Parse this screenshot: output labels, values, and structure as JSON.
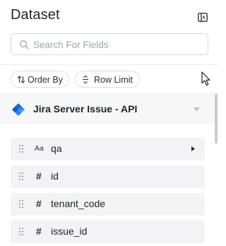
{
  "header": {
    "title": "Dataset"
  },
  "search": {
    "placeholder": "Search For Fields",
    "value": ""
  },
  "toolbar": {
    "order_by_label": "Order By",
    "row_limit_label": "Row Limit"
  },
  "source": {
    "name": "Jira Server Issue - API"
  },
  "fields": [
    {
      "label": "qa",
      "type_symbol": "Aa",
      "expandable": true
    },
    {
      "label": "id",
      "type_symbol": "#",
      "expandable": false
    },
    {
      "label": "tenant_code",
      "type_symbol": "#",
      "expandable": false
    },
    {
      "label": "issue_id",
      "type_symbol": "#",
      "expandable": false
    }
  ],
  "colors": {
    "text": "#22252a",
    "placeholder": "#a0a4ab",
    "field_bg": "#f3f3f5",
    "source_bar_bg": "#f7f7f8",
    "jira_blue": "#2684ff"
  }
}
